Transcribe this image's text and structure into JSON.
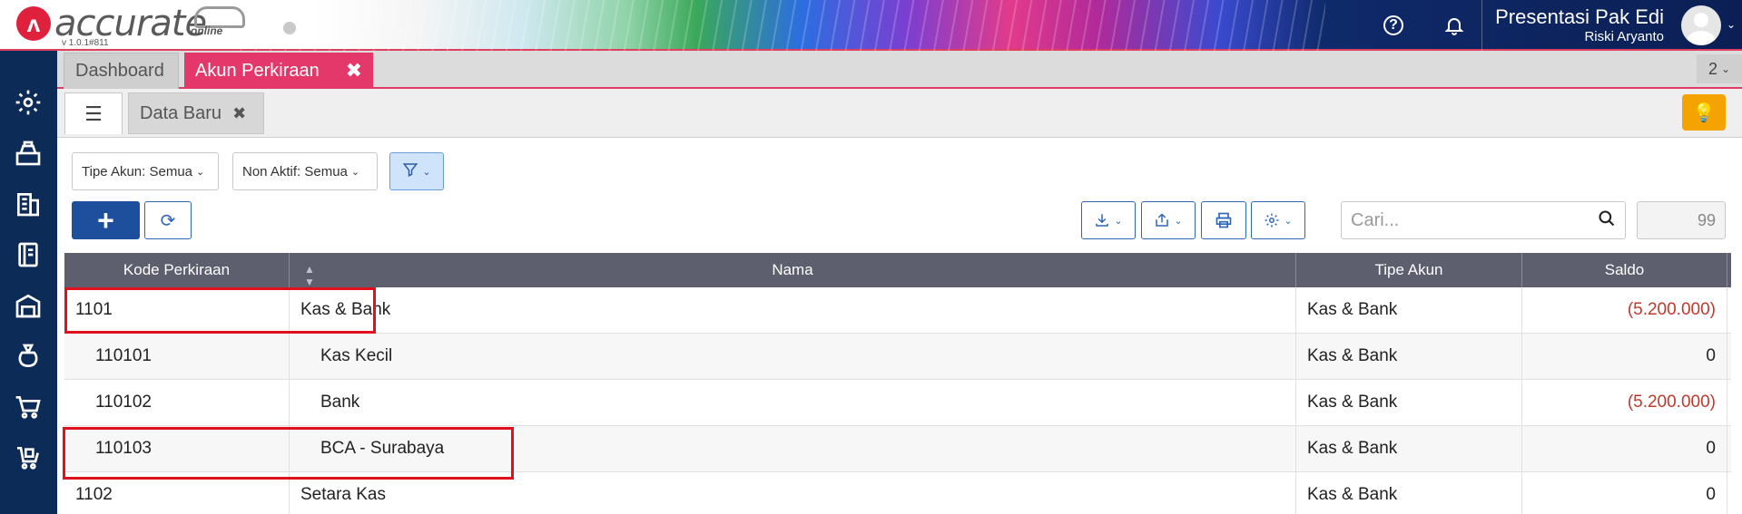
{
  "app": {
    "logo_text": "accurate",
    "logo_sub": "online",
    "version": "v 1.0.1#811",
    "company": "Presentasi Pak Edi",
    "user": "Riski Aryanto"
  },
  "tabs": {
    "items": [
      {
        "label": "Dashboard"
      },
      {
        "label": "Akun Perkiraan"
      }
    ],
    "close": "✖",
    "count": "2"
  },
  "subtabs": {
    "data_baru": "Data Baru",
    "close": "✖"
  },
  "filters": {
    "tipe_akun": "Tipe Akun: Semua",
    "non_aktif": "Non Aktif: Semua"
  },
  "search": {
    "placeholder": "Cari...",
    "page_size": "99"
  },
  "table": {
    "headers": [
      "Kode Perkiraan",
      "Nama",
      "Tipe Akun",
      "Saldo"
    ],
    "rows": [
      {
        "kode": "1101",
        "nama": "Kas & Bank",
        "tipe": "Kas & Bank",
        "saldo": "(5.200.000)",
        "level": 0,
        "negative": true
      },
      {
        "kode": "110101",
        "nama": "Kas Kecil",
        "tipe": "Kas & Bank",
        "saldo": "0",
        "level": 1,
        "negative": false
      },
      {
        "kode": "110102",
        "nama": "Bank",
        "tipe": "Kas & Bank",
        "saldo": "(5.200.000)",
        "level": 1,
        "negative": true
      },
      {
        "kode": "110103",
        "nama": "BCA - Surabaya",
        "tipe": "Kas & Bank",
        "saldo": "0",
        "level": 1,
        "negative": false
      },
      {
        "kode": "1102",
        "nama": "Setara Kas",
        "tipe": "Kas & Bank",
        "saldo": "0",
        "level": 0,
        "negative": false
      }
    ]
  },
  "colors": {
    "sidebar": "#0d2b57",
    "active_tab": "#e5386a",
    "primary": "#1d4f9c",
    "negative": "#c0392b",
    "header": "#5d5e6e",
    "highlight": "#e0101e"
  },
  "icons": {
    "sidebar": [
      "settings-icon",
      "cash-register-icon",
      "building-icon",
      "ledger-icon",
      "warehouse-icon",
      "money-bag-icon",
      "cart-icon",
      "cart-box-icon"
    ]
  }
}
